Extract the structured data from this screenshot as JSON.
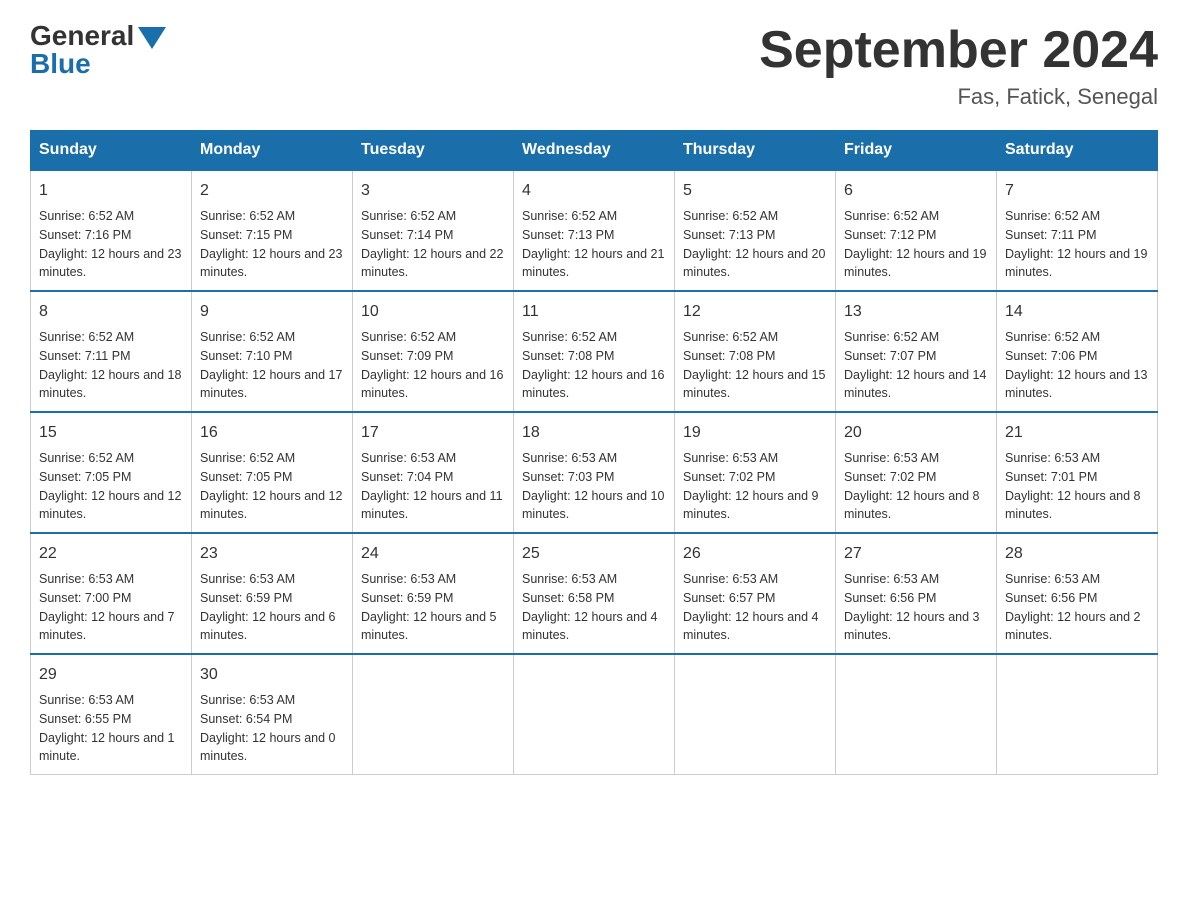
{
  "header": {
    "logo_general": "General",
    "logo_blue": "Blue",
    "month_title": "September 2024",
    "location": "Fas, Fatick, Senegal"
  },
  "weekdays": [
    "Sunday",
    "Monday",
    "Tuesday",
    "Wednesday",
    "Thursday",
    "Friday",
    "Saturday"
  ],
  "weeks": [
    [
      {
        "day": "1",
        "sunrise": "Sunrise: 6:52 AM",
        "sunset": "Sunset: 7:16 PM",
        "daylight": "Daylight: 12 hours and 23 minutes."
      },
      {
        "day": "2",
        "sunrise": "Sunrise: 6:52 AM",
        "sunset": "Sunset: 7:15 PM",
        "daylight": "Daylight: 12 hours and 23 minutes."
      },
      {
        "day": "3",
        "sunrise": "Sunrise: 6:52 AM",
        "sunset": "Sunset: 7:14 PM",
        "daylight": "Daylight: 12 hours and 22 minutes."
      },
      {
        "day": "4",
        "sunrise": "Sunrise: 6:52 AM",
        "sunset": "Sunset: 7:13 PM",
        "daylight": "Daylight: 12 hours and 21 minutes."
      },
      {
        "day": "5",
        "sunrise": "Sunrise: 6:52 AM",
        "sunset": "Sunset: 7:13 PM",
        "daylight": "Daylight: 12 hours and 20 minutes."
      },
      {
        "day": "6",
        "sunrise": "Sunrise: 6:52 AM",
        "sunset": "Sunset: 7:12 PM",
        "daylight": "Daylight: 12 hours and 19 minutes."
      },
      {
        "day": "7",
        "sunrise": "Sunrise: 6:52 AM",
        "sunset": "Sunset: 7:11 PM",
        "daylight": "Daylight: 12 hours and 19 minutes."
      }
    ],
    [
      {
        "day": "8",
        "sunrise": "Sunrise: 6:52 AM",
        "sunset": "Sunset: 7:11 PM",
        "daylight": "Daylight: 12 hours and 18 minutes."
      },
      {
        "day": "9",
        "sunrise": "Sunrise: 6:52 AM",
        "sunset": "Sunset: 7:10 PM",
        "daylight": "Daylight: 12 hours and 17 minutes."
      },
      {
        "day": "10",
        "sunrise": "Sunrise: 6:52 AM",
        "sunset": "Sunset: 7:09 PM",
        "daylight": "Daylight: 12 hours and 16 minutes."
      },
      {
        "day": "11",
        "sunrise": "Sunrise: 6:52 AM",
        "sunset": "Sunset: 7:08 PM",
        "daylight": "Daylight: 12 hours and 16 minutes."
      },
      {
        "day": "12",
        "sunrise": "Sunrise: 6:52 AM",
        "sunset": "Sunset: 7:08 PM",
        "daylight": "Daylight: 12 hours and 15 minutes."
      },
      {
        "day": "13",
        "sunrise": "Sunrise: 6:52 AM",
        "sunset": "Sunset: 7:07 PM",
        "daylight": "Daylight: 12 hours and 14 minutes."
      },
      {
        "day": "14",
        "sunrise": "Sunrise: 6:52 AM",
        "sunset": "Sunset: 7:06 PM",
        "daylight": "Daylight: 12 hours and 13 minutes."
      }
    ],
    [
      {
        "day": "15",
        "sunrise": "Sunrise: 6:52 AM",
        "sunset": "Sunset: 7:05 PM",
        "daylight": "Daylight: 12 hours and 12 minutes."
      },
      {
        "day": "16",
        "sunrise": "Sunrise: 6:52 AM",
        "sunset": "Sunset: 7:05 PM",
        "daylight": "Daylight: 12 hours and 12 minutes."
      },
      {
        "day": "17",
        "sunrise": "Sunrise: 6:53 AM",
        "sunset": "Sunset: 7:04 PM",
        "daylight": "Daylight: 12 hours and 11 minutes."
      },
      {
        "day": "18",
        "sunrise": "Sunrise: 6:53 AM",
        "sunset": "Sunset: 7:03 PM",
        "daylight": "Daylight: 12 hours and 10 minutes."
      },
      {
        "day": "19",
        "sunrise": "Sunrise: 6:53 AM",
        "sunset": "Sunset: 7:02 PM",
        "daylight": "Daylight: 12 hours and 9 minutes."
      },
      {
        "day": "20",
        "sunrise": "Sunrise: 6:53 AM",
        "sunset": "Sunset: 7:02 PM",
        "daylight": "Daylight: 12 hours and 8 minutes."
      },
      {
        "day": "21",
        "sunrise": "Sunrise: 6:53 AM",
        "sunset": "Sunset: 7:01 PM",
        "daylight": "Daylight: 12 hours and 8 minutes."
      }
    ],
    [
      {
        "day": "22",
        "sunrise": "Sunrise: 6:53 AM",
        "sunset": "Sunset: 7:00 PM",
        "daylight": "Daylight: 12 hours and 7 minutes."
      },
      {
        "day": "23",
        "sunrise": "Sunrise: 6:53 AM",
        "sunset": "Sunset: 6:59 PM",
        "daylight": "Daylight: 12 hours and 6 minutes."
      },
      {
        "day": "24",
        "sunrise": "Sunrise: 6:53 AM",
        "sunset": "Sunset: 6:59 PM",
        "daylight": "Daylight: 12 hours and 5 minutes."
      },
      {
        "day": "25",
        "sunrise": "Sunrise: 6:53 AM",
        "sunset": "Sunset: 6:58 PM",
        "daylight": "Daylight: 12 hours and 4 minutes."
      },
      {
        "day": "26",
        "sunrise": "Sunrise: 6:53 AM",
        "sunset": "Sunset: 6:57 PM",
        "daylight": "Daylight: 12 hours and 4 minutes."
      },
      {
        "day": "27",
        "sunrise": "Sunrise: 6:53 AM",
        "sunset": "Sunset: 6:56 PM",
        "daylight": "Daylight: 12 hours and 3 minutes."
      },
      {
        "day": "28",
        "sunrise": "Sunrise: 6:53 AM",
        "sunset": "Sunset: 6:56 PM",
        "daylight": "Daylight: 12 hours and 2 minutes."
      }
    ],
    [
      {
        "day": "29",
        "sunrise": "Sunrise: 6:53 AM",
        "sunset": "Sunset: 6:55 PM",
        "daylight": "Daylight: 12 hours and 1 minute."
      },
      {
        "day": "30",
        "sunrise": "Sunrise: 6:53 AM",
        "sunset": "Sunset: 6:54 PM",
        "daylight": "Daylight: 12 hours and 0 minutes."
      },
      null,
      null,
      null,
      null,
      null
    ]
  ]
}
